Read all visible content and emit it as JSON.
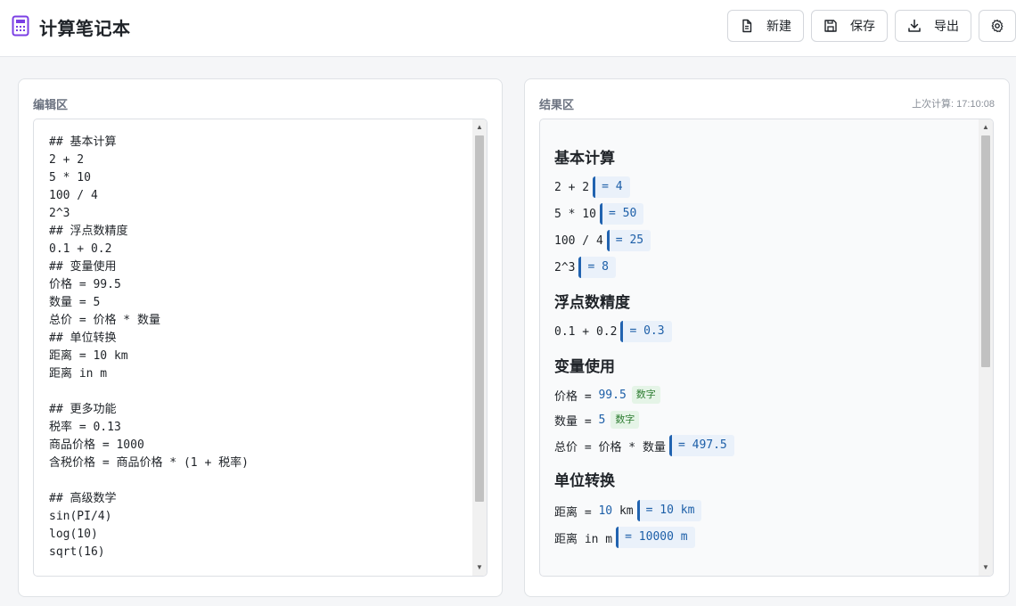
{
  "header": {
    "title": "计算笔记本",
    "logo_icon": "calculator-icon",
    "accent_color": "#7b3fe4",
    "buttons": {
      "new": {
        "label": "新建",
        "icon": "file-icon"
      },
      "save": {
        "label": "保存",
        "icon": "save-icon"
      },
      "export": {
        "label": "导出",
        "icon": "download-icon"
      },
      "settings": {
        "icon": "gear-icon"
      }
    }
  },
  "editor": {
    "title": "编辑区",
    "lines": [
      "## 基本计算",
      "2 + 2",
      "5 * 10",
      "100 / 4",
      "2^3",
      "## 浮点数精度",
      "0.1 + 0.2",
      "## 变量使用",
      "价格 = 99.5",
      "数量 = 5",
      "总价 = 价格 * 数量",
      "## 单位转换",
      "距离 = 10 km",
      "距离 in m",
      "",
      "## 更多功能",
      "税率 = 0.13",
      "商品价格 = 1000",
      "含税价格 = 商品价格 * (1 + 税率)",
      "",
      "## 高级数学",
      "sin(PI/4)",
      "log(10)",
      "sqrt(16)"
    ]
  },
  "results": {
    "title": "结果区",
    "last_calc": "上次计算: 17:10:08",
    "sections": {
      "basic": {
        "heading": "基本计算",
        "rows": [
          {
            "expr": "2 + 2",
            "answer": "= 4"
          },
          {
            "expr": "5 * 10",
            "answer": "= 50"
          },
          {
            "expr": "100 / 4",
            "answer": "= 25"
          },
          {
            "expr": "2^3",
            "answer": "= 8"
          }
        ]
      },
      "float": {
        "heading": "浮点数精度",
        "rows": [
          {
            "expr": "0.1 + 0.2",
            "answer": "= 0.3"
          }
        ]
      },
      "vars": {
        "heading": "变量使用",
        "rows": [
          {
            "name": "价格 = ",
            "value": "99.5",
            "badge": "数字"
          },
          {
            "name": "数量 = ",
            "value": "5",
            "badge": "数字"
          },
          {
            "expr": "总价 = 价格 * 数量",
            "answer": "= 497.5"
          }
        ]
      },
      "units": {
        "heading": "单位转换",
        "rows": [
          {
            "name": "距离 = ",
            "value": "10",
            "unit": " km",
            "answer": "= 10 km"
          },
          {
            "expr": "距离 in m",
            "answer": "= 10000 m"
          }
        ]
      }
    }
  }
}
